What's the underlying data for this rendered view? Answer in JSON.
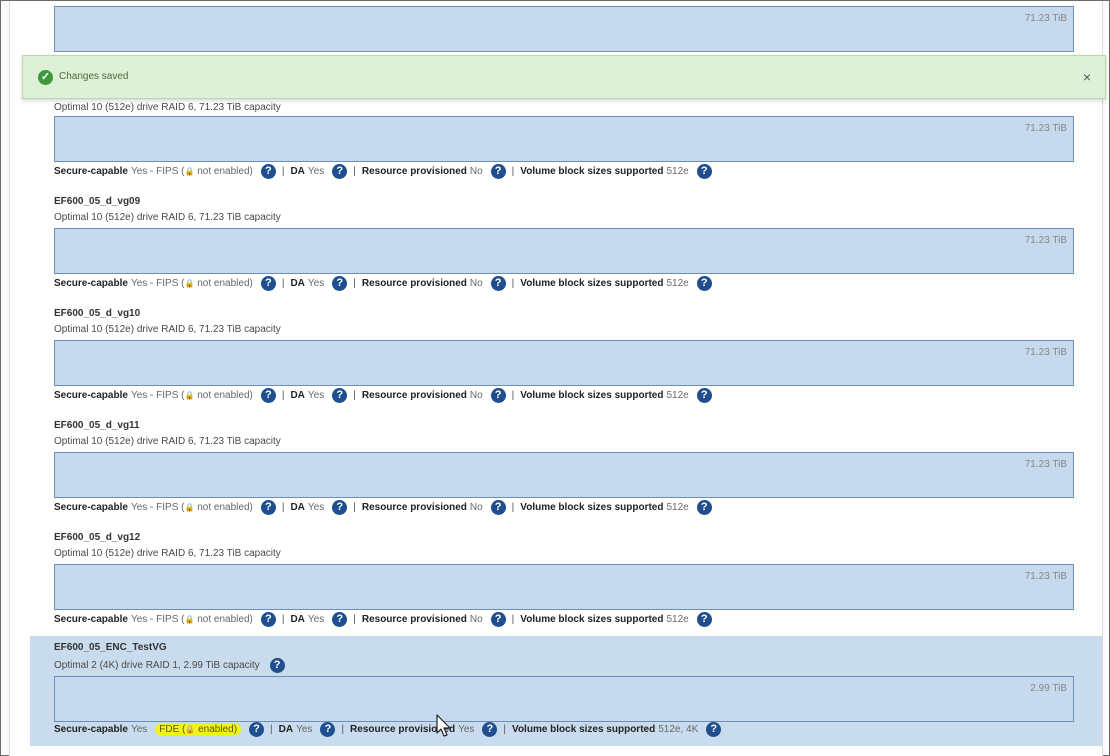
{
  "toast": {
    "message": "Changes saved",
    "close": "×"
  },
  "groups": [
    {
      "name": "",
      "subtitle": "",
      "capacity_label": "71.23 TiB",
      "properties": null
    },
    {
      "name": "",
      "subtitle": "Optimal 10 (512e) drive RAID 6, 71.23 TiB capacity",
      "capacity_label": "71.23 TiB",
      "properties": {
        "secure_label": "Secure-capable",
        "secure_value": "Yes - FIPS (",
        "secure_tail": " not enabled)",
        "da_label": "DA",
        "da_value": "Yes",
        "rp_label": "Resource provisioned",
        "rp_value": "No",
        "vbs_label": "Volume block sizes supported",
        "vbs_value": "512e"
      }
    },
    {
      "name": "EF600_05_d_vg09",
      "subtitle": "Optimal 10 (512e) drive RAID 6, 71.23 TiB capacity",
      "capacity_label": "71.23 TiB",
      "properties": {
        "secure_label": "Secure-capable",
        "secure_value": "Yes - FIPS (",
        "secure_tail": " not enabled)",
        "da_label": "DA",
        "da_value": "Yes",
        "rp_label": "Resource provisioned",
        "rp_value": "No",
        "vbs_label": "Volume block sizes supported",
        "vbs_value": "512e"
      }
    },
    {
      "name": "EF600_05_d_vg10",
      "subtitle": "Optimal 10 (512e) drive RAID 6, 71.23 TiB capacity",
      "capacity_label": "71.23 TiB",
      "properties": {
        "secure_label": "Secure-capable",
        "secure_value": "Yes - FIPS (",
        "secure_tail": " not enabled)",
        "da_label": "DA",
        "da_value": "Yes",
        "rp_label": "Resource provisioned",
        "rp_value": "No",
        "vbs_label": "Volume block sizes supported",
        "vbs_value": "512e"
      }
    },
    {
      "name": "EF600_05_d_vg11",
      "subtitle": "Optimal 10 (512e) drive RAID 6, 71.23 TiB capacity",
      "capacity_label": "71.23 TiB",
      "properties": {
        "secure_label": "Secure-capable",
        "secure_value": "Yes - FIPS (",
        "secure_tail": " not enabled)",
        "da_label": "DA",
        "da_value": "Yes",
        "rp_label": "Resource provisioned",
        "rp_value": "No",
        "vbs_label": "Volume block sizes supported",
        "vbs_value": "512e"
      }
    },
    {
      "name": "EF600_05_d_vg12",
      "subtitle": "Optimal 10 (512e) drive RAID 6, 71.23 TiB capacity",
      "capacity_label": "71.23 TiB",
      "properties": {
        "secure_label": "Secure-capable",
        "secure_value": "Yes - FIPS (",
        "secure_tail": " not enabled)",
        "da_label": "DA",
        "da_value": "Yes",
        "rp_label": "Resource provisioned",
        "rp_value": "No",
        "vbs_label": "Volume block sizes supported",
        "vbs_value": "512e"
      }
    },
    {
      "name": "EF600_05_ENC_TestVG",
      "subtitle": "Optimal 2 (4K) drive RAID 1, 2.99 TiB capacity",
      "capacity_label": "2.99 TiB",
      "properties": {
        "secure_label": "Secure-capable",
        "secure_value": "Yes",
        "fde_text": "FDE (",
        "fde_tail": " enabled)",
        "da_label": "DA",
        "da_value": "Yes",
        "rp_label": "Resource provisioned",
        "rp_value": "Yes",
        "vbs_label": "Volume block sizes supported",
        "vbs_value": "512e, 4K"
      }
    }
  ],
  "icons": {
    "help": "?",
    "lock": "🔒",
    "check": "✓"
  },
  "colors": {
    "bar_fill": "#c6d9ee",
    "bar_border": "#6d8fb5",
    "highlight_row": "#c9dcee",
    "help_icon": "#1f4f8f",
    "toast_bg": "#dff0d8",
    "fde_highlight": "#f2f21c"
  }
}
